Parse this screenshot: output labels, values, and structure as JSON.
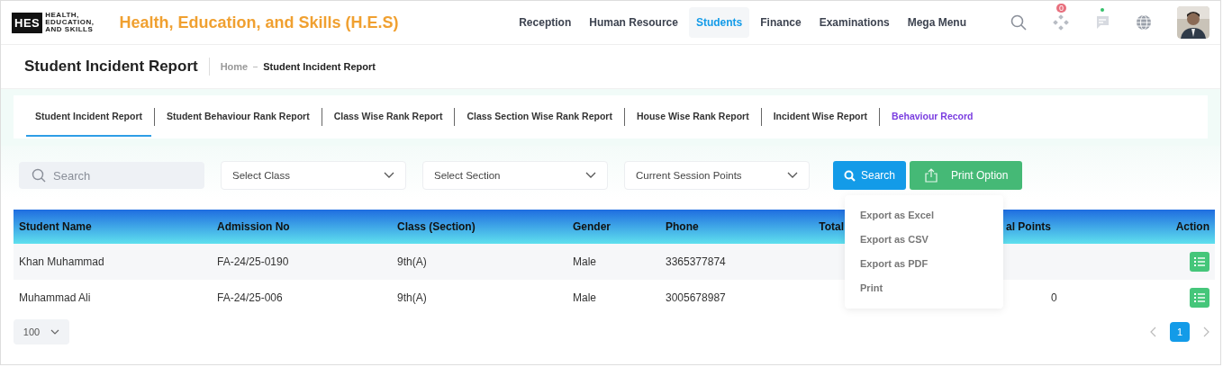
{
  "header": {
    "logo_mark": "HES",
    "logo_lines": [
      "HEALTH,",
      "EDUCATION,",
      "AND SKILLS"
    ],
    "title": "Health, Education, and Skills (H.E.S)",
    "nav": [
      {
        "label": "Reception",
        "selected": false
      },
      {
        "label": "Human Resource",
        "selected": false
      },
      {
        "label": "Students",
        "selected": true
      },
      {
        "label": "Finance",
        "selected": false
      },
      {
        "label": "Examinations",
        "selected": false
      },
      {
        "label": "Mega Menu",
        "selected": false
      }
    ],
    "apps_badge": "0",
    "chat_online": true
  },
  "page": {
    "title": "Student Incident Report",
    "breadcrumb": [
      "Home",
      "Student Incident Report"
    ]
  },
  "tabs": [
    {
      "label": "Student Incident Report",
      "selected": true,
      "highlighted": false
    },
    {
      "label": "Student Behaviour Rank Report",
      "selected": false,
      "highlighted": false
    },
    {
      "label": "Class Wise Rank Report",
      "selected": false,
      "highlighted": false
    },
    {
      "label": "Class Section Wise Rank Report",
      "selected": false,
      "highlighted": false
    },
    {
      "label": "House Wise Rank Report",
      "selected": false,
      "highlighted": false
    },
    {
      "label": "Incident Wise Report",
      "selected": false,
      "highlighted": false
    },
    {
      "label": "Behaviour Record",
      "selected": false,
      "highlighted": true
    }
  ],
  "filters": {
    "search": {
      "placeholder": "Search"
    },
    "selects": [
      "Select Class",
      "Select Section",
      "Current Session Points"
    ],
    "search_button": "Search",
    "print_button": "Print Option"
  },
  "print_menu": {
    "open": true,
    "items": [
      "Export as Excel",
      "Export as CSV",
      "Export as PDF",
      "Print"
    ]
  },
  "table": {
    "columns": [
      "Student Name",
      "Admission No",
      "Class (Section)",
      "Gender",
      "Phone",
      "Total",
      "al Points",
      "Action"
    ],
    "rows": [
      {
        "cells": [
          "Khan Muhammad",
          "FA-24/25-0190",
          "9th(A)",
          "Male",
          "3365377874",
          ""
        ]
      },
      {
        "cells": [
          "Muhammad Ali",
          "FA-24/25-006",
          "9th(A)",
          "Male",
          "3005678987",
          "0"
        ]
      }
    ]
  },
  "footer": {
    "page_size": "100",
    "pages": [
      {
        "label": "1",
        "selected": true
      }
    ]
  }
}
